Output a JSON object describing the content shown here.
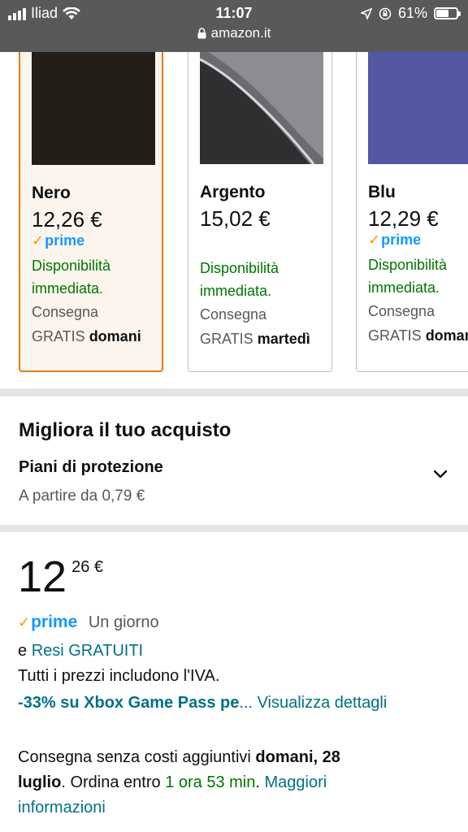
{
  "status_bar": {
    "carrier": "Iliad",
    "time": "11:07",
    "battery": "61%",
    "battery_level": 0.61,
    "url": "amazon.it"
  },
  "variants": [
    {
      "name": "Nero",
      "price": "12,26 €",
      "prime": "prime",
      "availability_1": "Disponibilità",
      "availability_2": "immediata.",
      "delivery_1": "Consegna",
      "delivery_2": "GRATIS",
      "delivery_day": "domani",
      "selected": true,
      "swatch_color": "#231f18"
    },
    {
      "name": "Argento",
      "price": "15,02 €",
      "prime": "",
      "availability_1": "Disponibilità",
      "availability_2": "immediata.",
      "delivery_1": "Consegna",
      "delivery_2": "GRATIS",
      "delivery_day": "martedì",
      "selected": false,
      "swatch_color": "#4a4b4e"
    },
    {
      "name": "Blu",
      "price": "12,29 €",
      "prime": "prime",
      "availability_1": "Disponibilità",
      "availability_2": "immediata.",
      "delivery_1": "Consegna",
      "delivery_2": "GRATIS",
      "delivery_day": "domani",
      "selected": false,
      "swatch_color": "#5257a2"
    }
  ],
  "improve": {
    "title": "Migliora il tuo acquisto",
    "protection_title": "Piani di protezione",
    "protection_price": "A partire da 0,79 €"
  },
  "price": {
    "whole": "12",
    "fraction": "26 €",
    "prime": "prime",
    "prime_delivery": "Un giorno",
    "returns_prefix": "e",
    "returns_link": "Resi GRATUITI",
    "vat_note": "Tutti i prezzi includono l'IVA.",
    "promo": "-33% su Xbox Game Pass pe",
    "details_link": "... Visualizza dettagli",
    "delivery_text": "Consegna senza costi aggiuntivi",
    "delivery_date_1": "domani, 28",
    "delivery_date_2": "luglio",
    "order_within": ". Ordina entro",
    "countdown": "1 ora 53 min",
    "more_info_1": "Maggiori",
    "more_info_2": "informazioni"
  },
  "colors": {
    "selected_border": "#e47911",
    "prime_blue": "#1399ff",
    "prime_check": "#ff9900",
    "availability_green": "#007600",
    "link_teal": "#007185"
  }
}
